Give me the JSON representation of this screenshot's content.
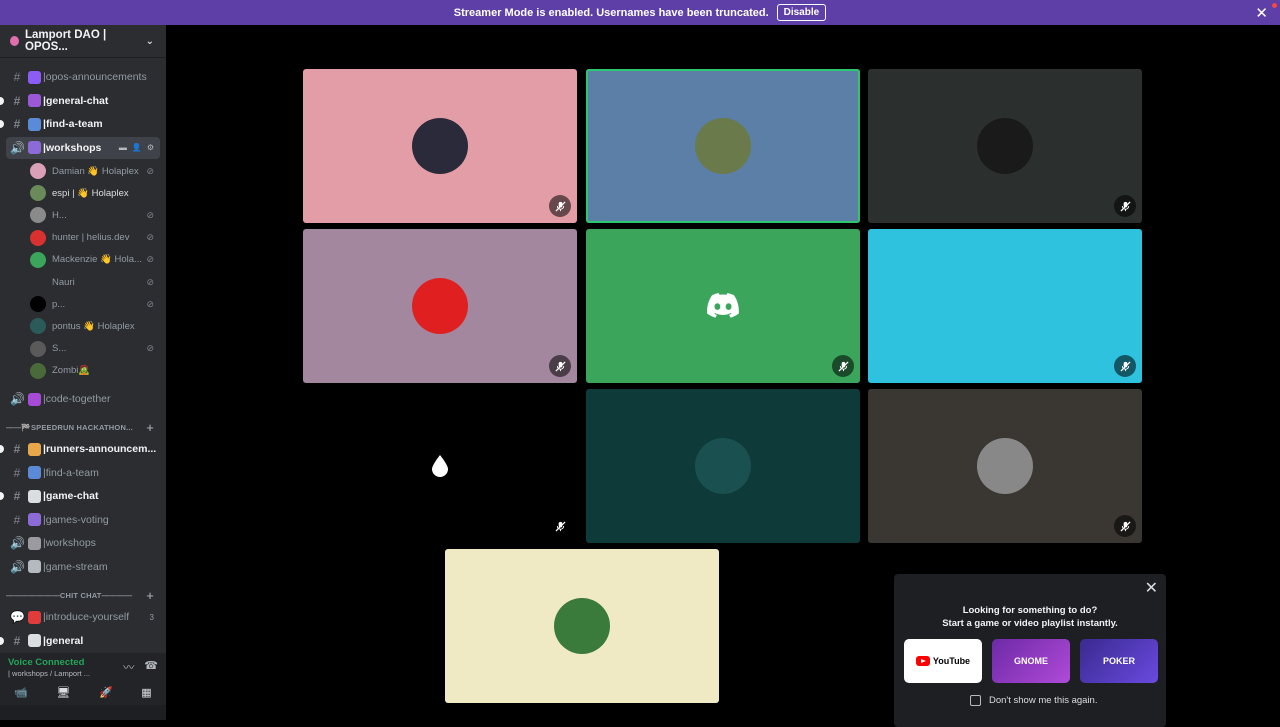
{
  "banner": {
    "message": "Streamer Mode is enabled. Usernames have been truncated.",
    "button": "Disable",
    "close": "✕"
  },
  "server": {
    "name": "Lamport DAO | OPOS...",
    "chevron": "⌄"
  },
  "channels": [
    {
      "label": "|opos-announcements",
      "icon": "#",
      "emoji_color": "#8b5cf6",
      "bright": false,
      "unread": false
    },
    {
      "label": "|general-chat",
      "icon": "#",
      "emoji_color": "#9b59d8",
      "bright": true,
      "unread": true
    },
    {
      "label": "|find-a-team",
      "icon": "#",
      "emoji_color": "#5b8bd6",
      "bright": true,
      "unread": true
    },
    {
      "label": "|workshops",
      "icon": "🔊",
      "emoji_color": "#8c6bd8",
      "bright": true,
      "active": true
    }
  ],
  "voice_users": [
    {
      "name": "Damian 👋 Holaplex",
      "avatar_color": "#d9a0b8",
      "muted": true
    },
    {
      "name": "espi | 👋 Holaplex",
      "avatar_color": "#6a8a5a",
      "muted": false,
      "bright": true
    },
    {
      "name": "H...",
      "avatar_color": "#8a8a8a",
      "muted": true
    },
    {
      "name": "hunter | helius.dev",
      "avatar_color": "#d93030",
      "muted": true
    },
    {
      "name": "Mackenzie 👋 Hola...",
      "avatar_color": "#3ba55c",
      "muted": true
    },
    {
      "name": "Nauri",
      "avatar_color": "#2b2d31",
      "muted": true
    },
    {
      "name": "p...",
      "avatar_color": "#000000",
      "muted": true
    },
    {
      "name": "pontus 👋 Holaplex",
      "avatar_color": "#2a5a5a",
      "muted": false
    },
    {
      "name": "S...",
      "avatar_color": "#5a5a5a",
      "muted": true
    },
    {
      "name": "Zombi🧟",
      "avatar_color": "#4a6a3a",
      "muted": false
    }
  ],
  "channels2": [
    {
      "label": "|code-together",
      "icon": "🔊",
      "emoji_color": "#a64bd8"
    }
  ],
  "category1": {
    "label": "——🏁SPEEDRUN HACKATHON...",
    "plus": "+"
  },
  "channels3": [
    {
      "label": "|runners-announcem...",
      "icon": "#",
      "emoji_color": "#e8a84a",
      "bright": true,
      "unread": true
    },
    {
      "label": "|find-a-team",
      "icon": "#",
      "emoji_color": "#5b8bd6",
      "bright": false
    },
    {
      "label": "|game-chat",
      "icon": "#",
      "emoji_color": "#dbdee1",
      "bright": true,
      "unread": true
    },
    {
      "label": "|games-voting",
      "icon": "#",
      "emoji_color": "#8c6bd8",
      "bright": false
    },
    {
      "label": "|workshops",
      "icon": "🔊",
      "emoji_color": "#9a9aa0",
      "bright": false
    },
    {
      "label": "|game-stream",
      "icon": "🔊",
      "emoji_color": "#b5bac1",
      "bright": false
    }
  ],
  "category2": {
    "label": "———————CHIT CHAT————",
    "plus": "+"
  },
  "channels4": [
    {
      "label": "|introduce-yourself",
      "icon": "💬",
      "emoji_color": "#e03c3c",
      "count": "3",
      "bright": false
    },
    {
      "label": "|general",
      "icon": "#",
      "emoji_color": "#dbdee1",
      "bright": true,
      "unread": true
    }
  ],
  "voice_panel": {
    "title": "Voice Connected",
    "subtitle": "| workshops / Lamport ...",
    "icons": [
      "sound-waves",
      "disconnect"
    ]
  },
  "actions": [
    "📹",
    "🖥",
    "🚀",
    "▦"
  ],
  "tiles": [
    {
      "bg": "#e39da6",
      "avatar": "#2a2a3a",
      "muted": true,
      "speaking": false
    },
    {
      "bg": "#5b7fa6",
      "avatar": "#6a7a4a",
      "muted": false,
      "speaking": true
    },
    {
      "bg": "#2b302e",
      "avatar": "#1a1a1a",
      "muted": true,
      "speaking": false
    },
    {
      "bg": "#a2879e",
      "avatar": "#e02020",
      "muted": true,
      "speaking": false
    },
    {
      "bg": "#3ba55c",
      "avatar": "discord",
      "muted": true,
      "speaking": false
    },
    {
      "bg": "#2ec2de",
      "avatar": "#2ec2de",
      "muted": true,
      "speaking": false
    },
    {
      "bg": "#000000",
      "avatar": "drop",
      "muted": true,
      "speaking": false
    },
    {
      "bg": "#0e3a3a",
      "avatar": "#1a5050",
      "muted": false,
      "speaking": false
    },
    {
      "bg": "#3a3733",
      "avatar": "#888888",
      "muted": true,
      "speaking": false
    },
    {
      "bg": "#efeac4",
      "avatar": "#3a7a3a",
      "muted": false,
      "speaking": false
    }
  ],
  "activity": {
    "close": "✕",
    "title_line1": "Looking for something to do?",
    "title_line2": "Start a game or video playlist instantly.",
    "cards": [
      "YouTube",
      "GNOME",
      "POKER"
    ],
    "checkbox_label": "Don't show me this again."
  }
}
